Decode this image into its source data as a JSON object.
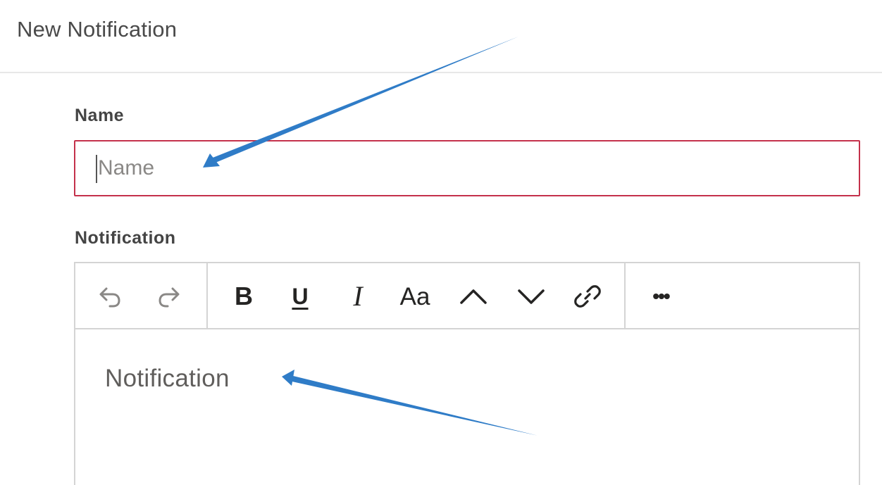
{
  "header": {
    "title": "New Notification"
  },
  "name_field": {
    "label": "Name",
    "placeholder": "Name",
    "value": ""
  },
  "notification_field": {
    "label": "Notification",
    "placeholder": "Notification",
    "toolbar": {
      "undo_icon": "undo-icon",
      "redo_icon": "redo-icon",
      "bold": "B",
      "underline": "U",
      "italic": "I",
      "font_size": "Aa",
      "superscript_icon": "chevron-up-icon",
      "subscript_icon": "chevron-down-icon",
      "link_icon": "link-icon",
      "more": "•••"
    }
  },
  "colors": {
    "error_border": "#c4314b",
    "annotation_arrow": "#2f7cc7",
    "label_text": "#444444",
    "placeholder_text": "#8a8886"
  }
}
